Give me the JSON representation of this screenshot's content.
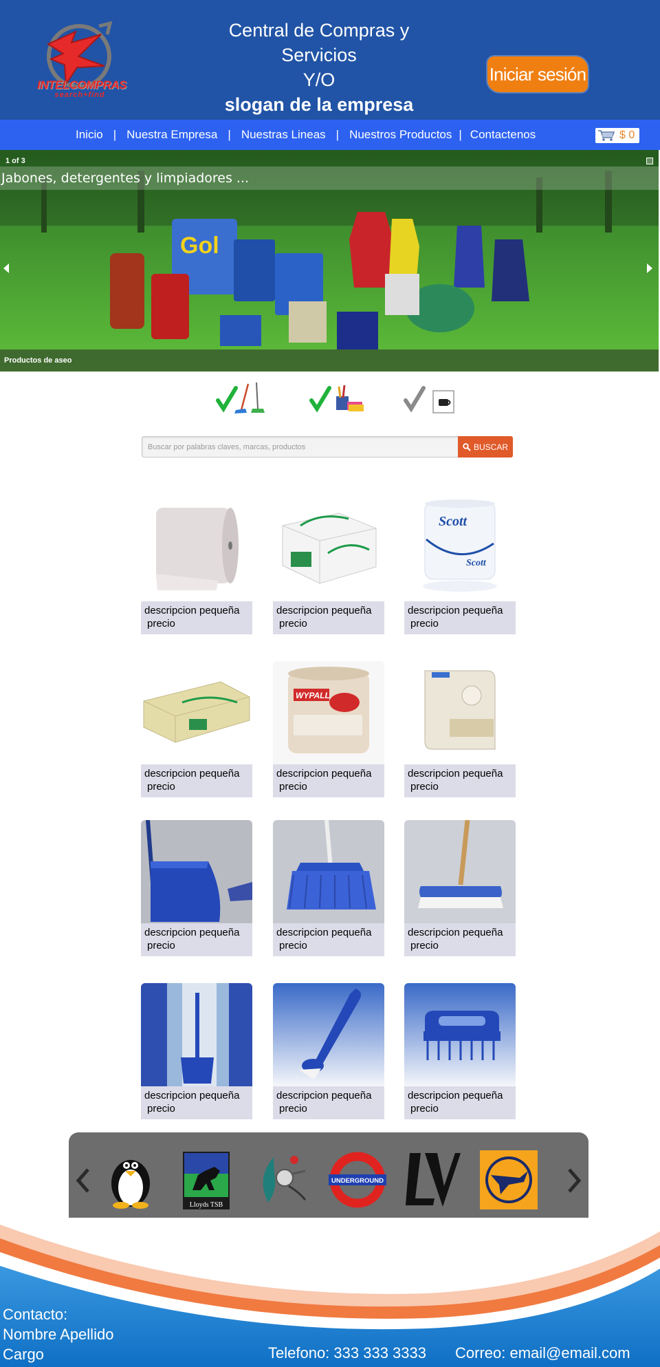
{
  "header": {
    "logo_text": "INTELCOMPRAS",
    "logo_sub": "search+find",
    "title_line1": "Central de Compras y",
    "title_line2": "Servicios",
    "title_line3": "Y/O",
    "slogan": "slogan de la empresa",
    "login_label": "Iniciar sesión",
    "brand_color": "#2154a6",
    "accent_color": "#f07f12"
  },
  "nav": {
    "items": [
      {
        "label": "Inicio"
      },
      {
        "label": "Nuestra Empresa"
      },
      {
        "label": "Nuestras Lineas"
      },
      {
        "label": "Nuestros Productos"
      },
      {
        "label": "Contactenos"
      }
    ],
    "separator": "|",
    "cart_amount": "$ 0",
    "nav_color": "#2d62f1"
  },
  "slider": {
    "counter": "1 of 3",
    "caption": "Jabones, detergentes y limpiadores ...",
    "footer": "Productos de aseo"
  },
  "categories": [
    {
      "icon": "broom-check-icon"
    },
    {
      "icon": "office-supplies-check-icon"
    },
    {
      "icon": "cafeteria-check-icon"
    }
  ],
  "search": {
    "placeholder": "Buscar por palabras claves, marcas, productos",
    "button_label": "BUSCAR"
  },
  "products": [
    {
      "description": "descripcion pequeña",
      "price": "precio"
    },
    {
      "description": "descripcion pequeña",
      "price": "precio"
    },
    {
      "description": "descripcion pequeña",
      "price": "precio"
    },
    {
      "description": "descripcion pequeña",
      "price": "precio"
    },
    {
      "description": "descripcion pequeña",
      "price": "precio"
    },
    {
      "description": "descripcion pequeña",
      "price": "precio"
    },
    {
      "description": "descripcion pequeña",
      "price": "precio"
    },
    {
      "description": "descripcion pequeña",
      "price": "precio"
    },
    {
      "description": "descripcion pequeña",
      "price": "precio"
    },
    {
      "description": "descripcion pequeña",
      "price": "precio"
    },
    {
      "description": "descripcion pequeña",
      "price": "precio"
    },
    {
      "description": "descripcion pequeña",
      "price": "precio"
    }
  ],
  "brands": {
    "items": [
      {
        "icon": "penguin-logo"
      },
      {
        "name": "Lloyds TSB"
      },
      {
        "icon": "abstract-drop-logo"
      },
      {
        "name": "UNDERGROUND"
      },
      {
        "icon": "lv-logo"
      },
      {
        "icon": "crane-logo"
      }
    ]
  },
  "footer": {
    "contact_label": "Contacto:",
    "name": "Nombre Apellido",
    "role": "Cargo",
    "phone": "Telefono: 333 333 3333",
    "email": "Correo: email@email.com"
  }
}
